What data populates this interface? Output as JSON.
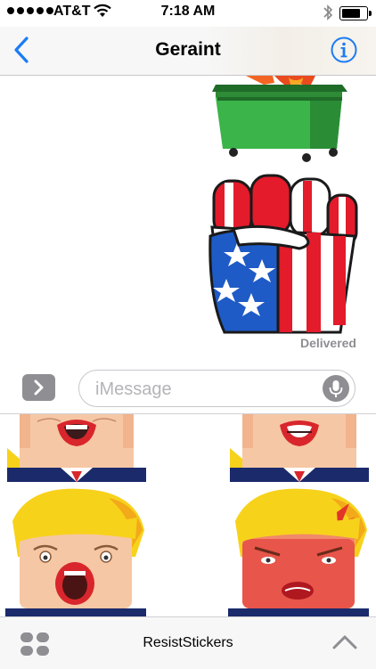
{
  "status_bar": {
    "carrier": "AT&T",
    "time": "7:18 AM",
    "signal_icon": "signal-dots-icon",
    "wifi_icon": "wifi-icon",
    "bluetooth_icon": "bluetooth-icon",
    "battery_icon": "battery-icon"
  },
  "nav": {
    "title": "Geraint",
    "back_icon": "chevron-left-icon",
    "info_icon": "info-icon",
    "accent_color": "#1a7cf5"
  },
  "conversation": {
    "stickers": [
      {
        "name": "dumpster-fire-sticker"
      },
      {
        "name": "flag-fist-sticker"
      }
    ],
    "status": "Delivered"
  },
  "input": {
    "placeholder": "iMessage",
    "value": "",
    "expand_icon": "chevron-right-icon",
    "mic_icon": "microphone-icon"
  },
  "sticker_drawer": {
    "rows": 2,
    "columns": 2
  },
  "app_bar": {
    "app_name": "ResistStickers",
    "apps_icon": "app-grid-icon",
    "collapse_icon": "chevron-up-icon"
  }
}
